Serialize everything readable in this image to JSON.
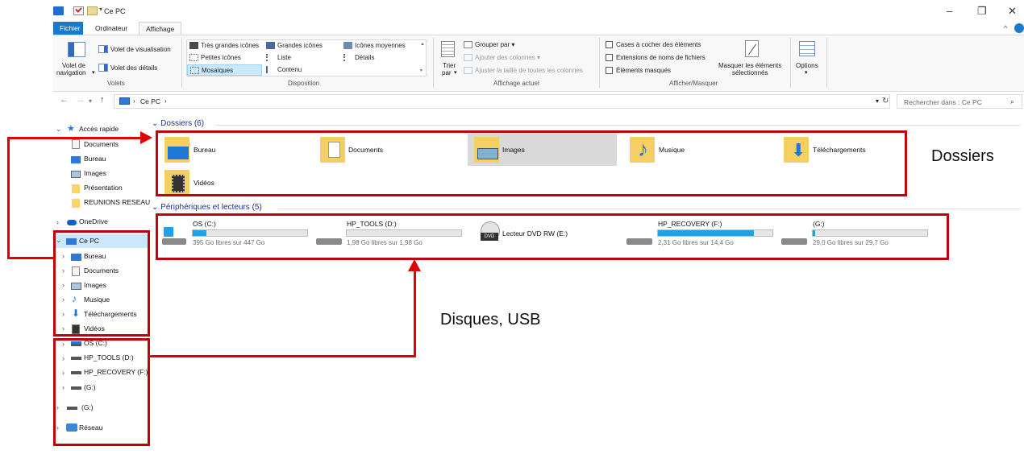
{
  "window": {
    "title": "Ce PC",
    "controls": {
      "minimize": "–",
      "maximize": "❐",
      "close": "✕"
    }
  },
  "ribbon": {
    "tabs": [
      "Fichier",
      "Ordinateur",
      "Affichage"
    ],
    "active_tab": "Affichage",
    "panes": {
      "nav_pane_line1": "Volet de",
      "nav_pane_line2": "navigation",
      "preview_pane": "Volet de visualisation",
      "details_pane": "Volet des détails",
      "group_label": "Volets"
    },
    "layout": {
      "very_large_icons": "Très grandes icônes",
      "large_icons": "Grandes icônes",
      "medium_icons": "Icônes moyennes",
      "small_icons": "Petites icônes",
      "list": "Liste",
      "details": "Détails",
      "tiles": "Mosaïques",
      "content": "Contenu",
      "group_label": "Disposition"
    },
    "current_view": {
      "sort_line1": "Trier",
      "sort_line2": "par",
      "group_by": "Grouper par",
      "add_columns": "Ajouter des colonnes",
      "size_columns": "Ajuster la taille de toutes les colonnes",
      "group_label": "Affichage actuel"
    },
    "show_hide": {
      "item_checkboxes": "Cases à cocher des éléments",
      "file_extensions": "Extensions de noms de fichiers",
      "hidden_items": "Éléments masqués",
      "hide_selected_line1": "Masquer les éléments",
      "hide_selected_line2": "sélectionnés",
      "group_label": "Afficher/Masquer"
    },
    "options": "Options"
  },
  "address_bar": {
    "path": "Ce PC",
    "search_placeholder": "Rechercher dans : Ce PC"
  },
  "sidebar": {
    "quick_access": "Accès rapide",
    "quick_items": [
      "Documents",
      "Bureau",
      "Images",
      "Présentation",
      "REUNIONS RESEAU"
    ],
    "onedrive": "OneDrive",
    "this_pc": "Ce PC",
    "pc_items": [
      "Bureau",
      "Documents",
      "Images",
      "Musique",
      "Téléchargements",
      "Vidéos"
    ],
    "drives": [
      "OS (C:)",
      "HP_TOOLS (D:)",
      "HP_RECOVERY (F:)",
      "(G:)"
    ],
    "g_drive": "(G:)",
    "network": "Réseau"
  },
  "content": {
    "folders_header": "Dossiers (6)",
    "folders": [
      "Bureau",
      "Documents",
      "Images",
      "Musique",
      "Téléchargements",
      "Vidéos"
    ],
    "devices_header": "Périphériques et lecteurs (5)",
    "drives": [
      {
        "name": "OS (C:)",
        "free": "395 Go libres sur 447 Go",
        "used_fraction": 0.12
      },
      {
        "name": "HP_TOOLS (D:)",
        "free": "1,98 Go libres sur 1,98 Go",
        "used_fraction": 0.0
      },
      {
        "name": "Lecteur DVD RW (E:)"
      },
      {
        "name": "HP_RECOVERY (F:)",
        "free": "2,31 Go libres sur 14,4 Go",
        "used_fraction": 0.84
      },
      {
        "name": "(G:)",
        "free": "29,0 Go libres sur 29,7 Go",
        "used_fraction": 0.02
      }
    ]
  },
  "annotations": {
    "folders_label": "Dossiers",
    "drives_label": "Disques, USB"
  },
  "colors": {
    "accent": "#1979ca",
    "annotation_red": "#c0000a",
    "selection": "#cce8ff",
    "drive_fill": "#26a0da"
  }
}
